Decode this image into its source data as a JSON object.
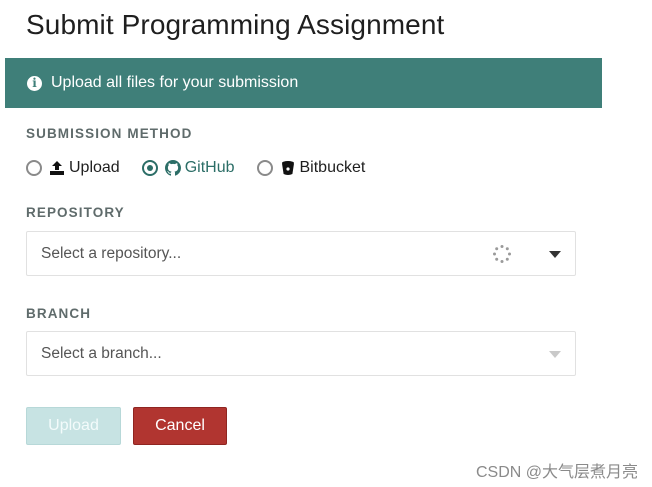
{
  "page": {
    "title": "Submit Programming Assignment"
  },
  "banner": {
    "icon": "info-icon",
    "text": "Upload all files for your submission",
    "background": "#3f7f79"
  },
  "submission_method": {
    "label": "SUBMISSION METHOD",
    "options": [
      {
        "label": "Upload",
        "icon": "upload-icon",
        "selected": false
      },
      {
        "label": "GitHub",
        "icon": "github-icon",
        "selected": true
      },
      {
        "label": "Bitbucket",
        "icon": "bitbucket-icon",
        "selected": false
      }
    ]
  },
  "repository": {
    "label": "REPOSITORY",
    "placeholder": "Select a repository...",
    "loading": true
  },
  "branch": {
    "label": "BRANCH",
    "placeholder": "Select a branch...",
    "disabled": true
  },
  "actions": {
    "upload_label": "Upload",
    "cancel_label": "Cancel",
    "upload_disabled": true
  },
  "watermark": "CSDN @大气层煮月亮",
  "colors": {
    "accent": "#2c6e67",
    "cancel": "#b13530",
    "upload_disabled": "#c7e3e3"
  }
}
